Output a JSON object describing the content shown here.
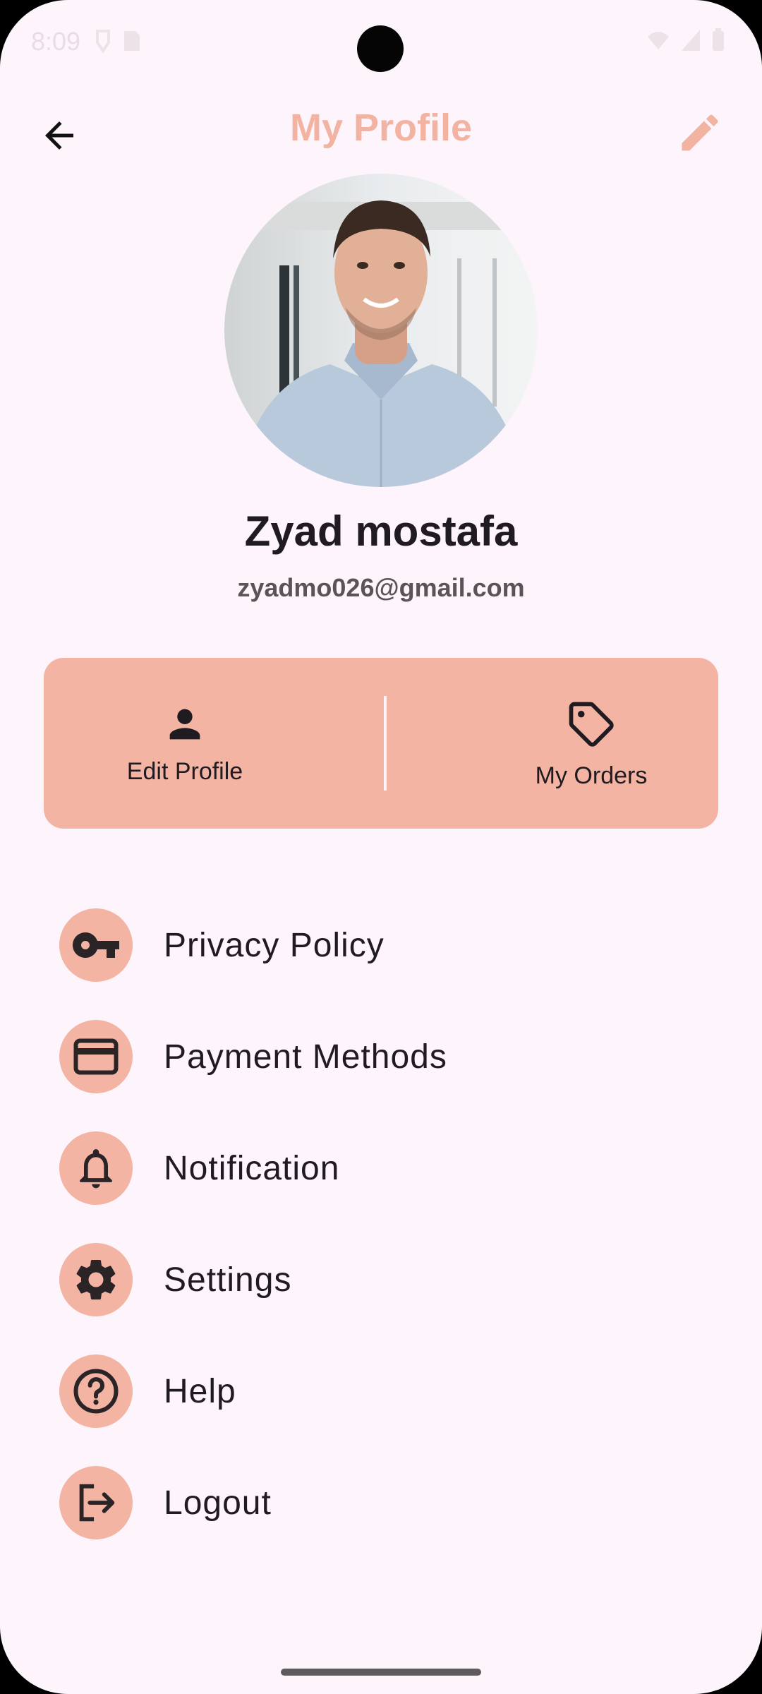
{
  "status_bar": {
    "time": "8:09",
    "icons": [
      "notification-icon",
      "sim-icon",
      "wifi-icon",
      "signal-icon",
      "battery-icon"
    ]
  },
  "header": {
    "title": "My Profile",
    "back_icon": "arrow-back-icon",
    "edit_icon": "pencil-icon"
  },
  "profile": {
    "name": "Zyad mostafa",
    "email": "zyadmo026@gmail.com"
  },
  "actions": [
    {
      "label": "Edit Profile",
      "icon": "person-icon"
    },
    {
      "label": "My Orders",
      "icon": "tag-icon"
    }
  ],
  "menu": [
    {
      "label": "Privacy Policy",
      "icon": "key-icon"
    },
    {
      "label": "Payment Methods",
      "icon": "credit-card-icon"
    },
    {
      "label": "Notification",
      "icon": "bell-icon"
    },
    {
      "label": "Settings",
      "icon": "gear-icon"
    },
    {
      "label": "Help",
      "icon": "help-icon"
    },
    {
      "label": "Logout",
      "icon": "logout-icon"
    }
  ],
  "colors": {
    "accent": "#f3b4a3",
    "title": "#f2b3a2",
    "background": "#fdf5fb",
    "text": "#1f1b20"
  }
}
